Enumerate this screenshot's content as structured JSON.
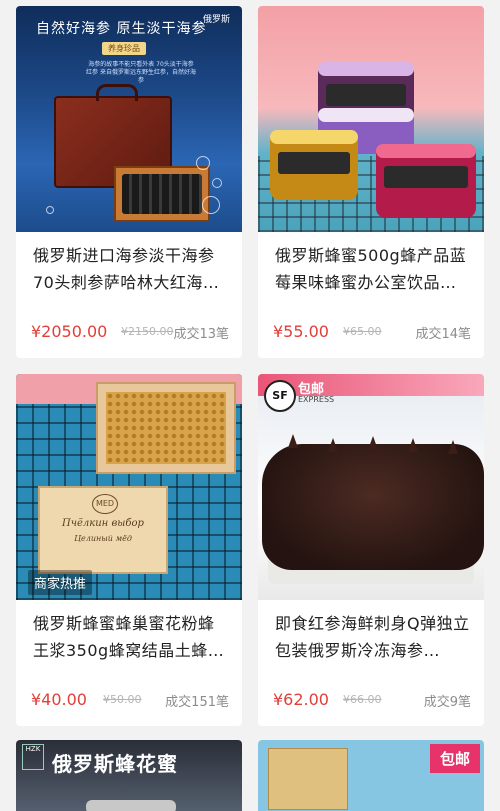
{
  "products": [
    {
      "title": "俄罗斯进口海参淡干海参70头刺参萨哈林大红海…",
      "price": "¥2050.00",
      "original_price": "¥2150.00",
      "sold": "成交13笔",
      "image": {
        "header": "自然好海参  原生淡干海参",
        "brand": "俄罗斯",
        "tag": "养身珍品",
        "desc": "海参的故事不能只看外表 70头淡干海参红参 来自俄罗斯远东野生红参，自然好海参"
      }
    },
    {
      "title": "俄罗斯蜂蜜500g蜂产品蓝莓果味蜂蜜办公室饮品…",
      "price": "¥55.00",
      "original_price": "¥65.00",
      "sold": "成交14笔"
    },
    {
      "title": "俄罗斯蜂蜜蜂巢蜜花粉蜂王浆350g蜂窝结晶土蜂…",
      "price": "¥40.00",
      "original_price": "¥50.00",
      "sold": "成交151笔",
      "image": {
        "badge": "商家热推",
        "logo": "MED",
        "label_line1": "Пчёлкин выбор",
        "label_line2": "Целиный мёд"
      }
    },
    {
      "title": "即食红参海鲜刺身Q弹独立包装俄罗斯冷冻海参…",
      "price": "¥62.00",
      "original_price": "¥66.00",
      "sold": "成交9笔",
      "image": {
        "sf_logo": "SF",
        "shipping": "包邮",
        "express": "EXPRESS"
      }
    },
    {
      "image": {
        "logo": "HZK",
        "text": "俄罗斯蜂花蜜"
      }
    },
    {
      "image": {
        "badge": "包邮"
      }
    }
  ]
}
